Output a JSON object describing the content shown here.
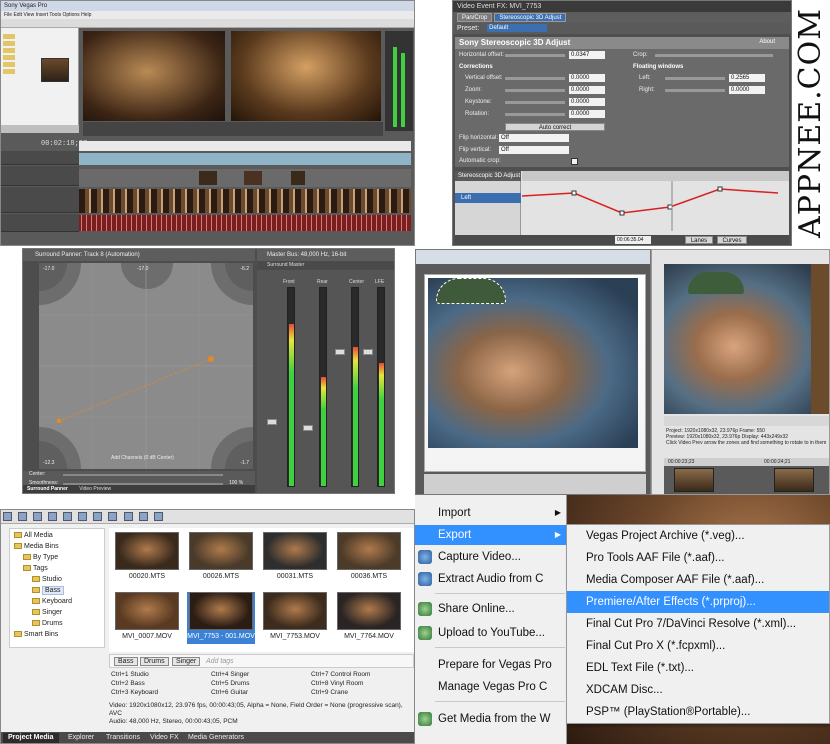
{
  "watermark": "APPNEE.COM",
  "colors": {
    "menu_highlight": "#3390ff",
    "selection_blue": "#3b6fb0",
    "meter_green": "#3fd13f",
    "keyframe_red": "#d82020"
  },
  "main_window": {
    "title": "Sony Vegas Pro",
    "menu": "File  Edit  View  Insert  Tools  Options  Help",
    "timecode": "00:02:18;27"
  },
  "event_fx": {
    "title": "Video Event FX:  MVI_7753",
    "tabs": [
      "Pan/Crop",
      "Stereoscopic 3D Adjust"
    ],
    "preset_label": "Preset:",
    "preset_value": "Default",
    "plugin_title": "Sony Stereoscopic 3D Adjust",
    "about": "About",
    "horizontal_offset_label": "Horizontal offset:",
    "horizontal_offset_value": "0.0347",
    "crop_label": "Crop:",
    "corrections_label": "Corrections",
    "floating_windows_label": "Floating windows",
    "rows": [
      {
        "label": "Vertical offset:",
        "value": "0.0000"
      },
      {
        "label": "Zoom:",
        "value": "0.0000"
      },
      {
        "label": "Keystone:",
        "value": "0.0000"
      },
      {
        "label": "Rotation:",
        "value": "0.0000"
      }
    ],
    "left_label": "Left:",
    "left_value": "0.2565",
    "right_label": "Right:",
    "right_value": "0.0000",
    "auto_correct": "Auto correct",
    "flip_horizontal_label": "Flip horizontal:",
    "flip_horizontal_value": "Off",
    "flip_vertical_label": "Flip vertical:",
    "flip_vertical_value": "Off",
    "automatic_crop_label": "Automatic crop:",
    "keyframe_head": "Stereoscopic 3D Adjust",
    "keyframe_track": "Left",
    "keyframe_end_time": "00:06:35.04",
    "lanes_btn": "Lanes",
    "curves_btn": "Curves"
  },
  "surround_panner": {
    "title": "Surround Panner: Track 8 (Automation)",
    "center_label": "Center:",
    "smoothness_label": "Smoothness:",
    "smoothness_value": "100 %",
    "note": "Add Channels (0 dB Center)",
    "tabs": [
      "Surround Panner",
      "Video Preview"
    ],
    "corner_labels": [
      "-17.0",
      "-17.0",
      "-6.2",
      "-12.3",
      "-1.7"
    ]
  },
  "master_bus": {
    "title": "Master Bus: 48,000 Hz, 16-bit",
    "subtitle": "Surround Master",
    "channels": [
      {
        "name": "Front",
        "level": 0.82
      },
      {
        "name": "Rear",
        "level": 0.55
      },
      {
        "name": "Center",
        "level": 0.7
      },
      {
        "name": "LFE",
        "level": 0.62
      }
    ]
  },
  "preview_right": {
    "info_lines": [
      "Project:   1920x1080x32, 23.976p      Frame:   550",
      "Preview:   1920x1080x32, 23.976p      Display: 443x249x32",
      "Click Video Prev arrow the zones and find something to rotate to in them"
    ],
    "timeline_marks": [
      "00:00:23;23",
      "00:00:24;21"
    ]
  },
  "project_media": {
    "tree": [
      {
        "label": "All Media",
        "indent": 0
      },
      {
        "label": "Media Bins",
        "indent": 0
      },
      {
        "label": "By Type",
        "indent": 1
      },
      {
        "label": "Tags",
        "indent": 1
      },
      {
        "label": "Studio",
        "indent": 2
      },
      {
        "label": "Bass",
        "indent": 2,
        "selected": true
      },
      {
        "label": "Keyboard",
        "indent": 2
      },
      {
        "label": "Singer",
        "indent": 2
      },
      {
        "label": "Drums",
        "indent": 2
      },
      {
        "label": "Smart Bins",
        "indent": 0
      }
    ],
    "clips": [
      {
        "name": "00020.MTS",
        "selected": false
      },
      {
        "name": "00026.MTS",
        "selected": false
      },
      {
        "name": "00031.MTS",
        "selected": false
      },
      {
        "name": "00036.MTS",
        "selected": false
      },
      {
        "name": "MVI_0007.MOV",
        "selected": false
      },
      {
        "name": "MVI_7753 - 001.MOV",
        "selected": true
      },
      {
        "name": "MVI_7753.MOV",
        "selected": false
      },
      {
        "name": "MVI_7764.MOV",
        "selected": false
      }
    ],
    "tags": [
      "Bass",
      "Drums",
      "Singer"
    ],
    "add_tags_placeholder": "Add tags",
    "shortcuts": [
      "Ctrl+1  Studio",
      "Ctrl+4  Singer",
      "Ctrl+7  Control Room",
      "Ctrl+2  Bass",
      "Ctrl+5  Drums",
      "Ctrl+8  Vinyl Room",
      "Ctrl+3  Keyboard",
      "Ctrl+6  Guitar",
      "Ctrl+9  Crane"
    ],
    "info_video": "Video: 1920x1080x12, 23.976 fps, 00:00:43;05, Alpha = None, Field Order = None (progressive scan), AVC",
    "info_audio": "Audio: 48,000 Hz, Stereo, 00:00:43;05, PCM",
    "bottom_tabs": [
      "Project Media",
      "Explorer",
      "Transitions",
      "Video FX",
      "Media Generators"
    ]
  },
  "context_menu": {
    "items": [
      {
        "label": "Import",
        "arrow": true,
        "icon": ""
      },
      {
        "label": "Export",
        "arrow": true,
        "highlight": true,
        "icon": ""
      },
      {
        "label": "Capture Video...",
        "icon": "capture-video-icon"
      },
      {
        "label": "Extract Audio from C",
        "icon": "extract-audio-icon"
      },
      {
        "label": "Share Online...",
        "icon": "share-online-icon"
      },
      {
        "label": "Upload to YouTube...",
        "icon": "upload-youtube-icon"
      },
      {
        "label": "Prepare for Vegas Pro",
        "icon": ""
      },
      {
        "label": "Manage Vegas Pro C",
        "icon": ""
      },
      {
        "label": "Get Media from the W",
        "icon": "get-media-icon"
      }
    ],
    "export_submenu": [
      {
        "label": "Vegas Project Archive (*.veg)..."
      },
      {
        "label": "Pro Tools AAF File (*.aaf)..."
      },
      {
        "label": "Media Composer AAF File (*.aaf)..."
      },
      {
        "label": "Premiere/After Effects (*.prproj)...",
        "highlight": true
      },
      {
        "label": "Final Cut Pro 7/DaVinci Resolve (*.xml)..."
      },
      {
        "label": "Final Cut Pro X (*.fcpxml)..."
      },
      {
        "label": "EDL Text File (*.txt)..."
      },
      {
        "label": "XDCAM Disc..."
      },
      {
        "label": "PSP™ (PlayStation®Portable)..."
      }
    ]
  }
}
